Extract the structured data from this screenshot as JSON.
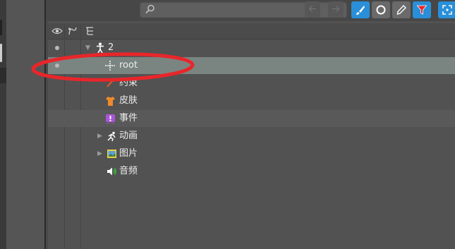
{
  "search": {
    "value": "",
    "placeholder": ""
  },
  "tools": [
    "bone-pose-tool",
    "circle-tool",
    "pen-tool",
    "filter-tool",
    "frame-tool"
  ],
  "columns": [
    "visibility-icon",
    "keyframe-icon",
    "tree-icon"
  ],
  "tree": {
    "skeleton": {
      "label": "2",
      "icon": "skeleton-icon",
      "expanded": true
    },
    "items": [
      {
        "label": "root",
        "icon": "bone-icon",
        "selected": true
      },
      {
        "label": "约束",
        "icon": "constraint-icon"
      },
      {
        "label": "皮肤",
        "icon": "skin-icon"
      },
      {
        "label": "事件",
        "icon": "event-icon"
      },
      {
        "label": "动画",
        "icon": "animation-icon",
        "expandable": true
      },
      {
        "label": "图片",
        "icon": "image-icon",
        "expandable": true
      },
      {
        "label": "音频",
        "icon": "audio-icon"
      }
    ]
  },
  "colors": {
    "accent": "#2a8fd8",
    "annotation": "#e8262a",
    "selected_row": "#7a8582"
  }
}
